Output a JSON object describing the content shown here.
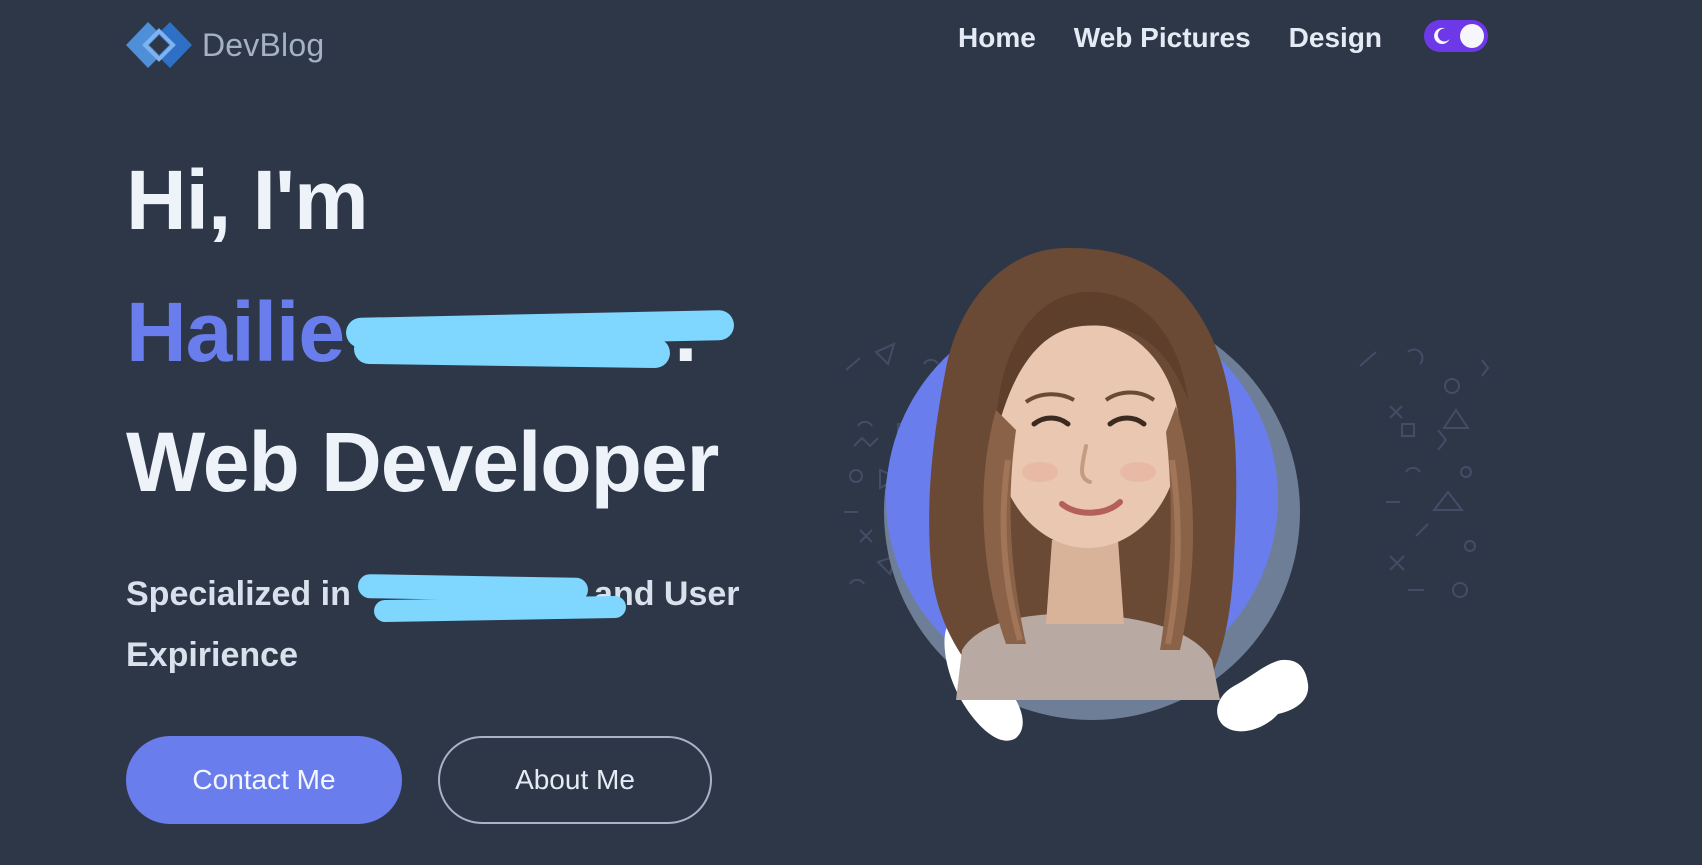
{
  "brand": {
    "name": "DevBlog",
    "logo_icon": "diamond-link-icon",
    "accent": "#6a7ded"
  },
  "nav": {
    "items": [
      {
        "label": "Home"
      },
      {
        "label": "Web Pictures"
      },
      {
        "label": "Design"
      }
    ],
    "theme_toggle": {
      "icon": "moon-icon",
      "state": "dark",
      "color": "#6d39e8"
    }
  },
  "hero": {
    "greeting": "Hi, I'm",
    "name": "Hailie",
    "name_suffix": ".",
    "role": "Web Developer",
    "tagline_before": "Specialized in",
    "tagline_after": "Interface and User Expirience",
    "primary_button": "Contact Me",
    "secondary_button": "About Me",
    "portrait_description": "person-portrait-photo"
  },
  "theme": {
    "background": "#2e3748",
    "text": "#eef3f9",
    "muted": "#a4b2c6"
  }
}
